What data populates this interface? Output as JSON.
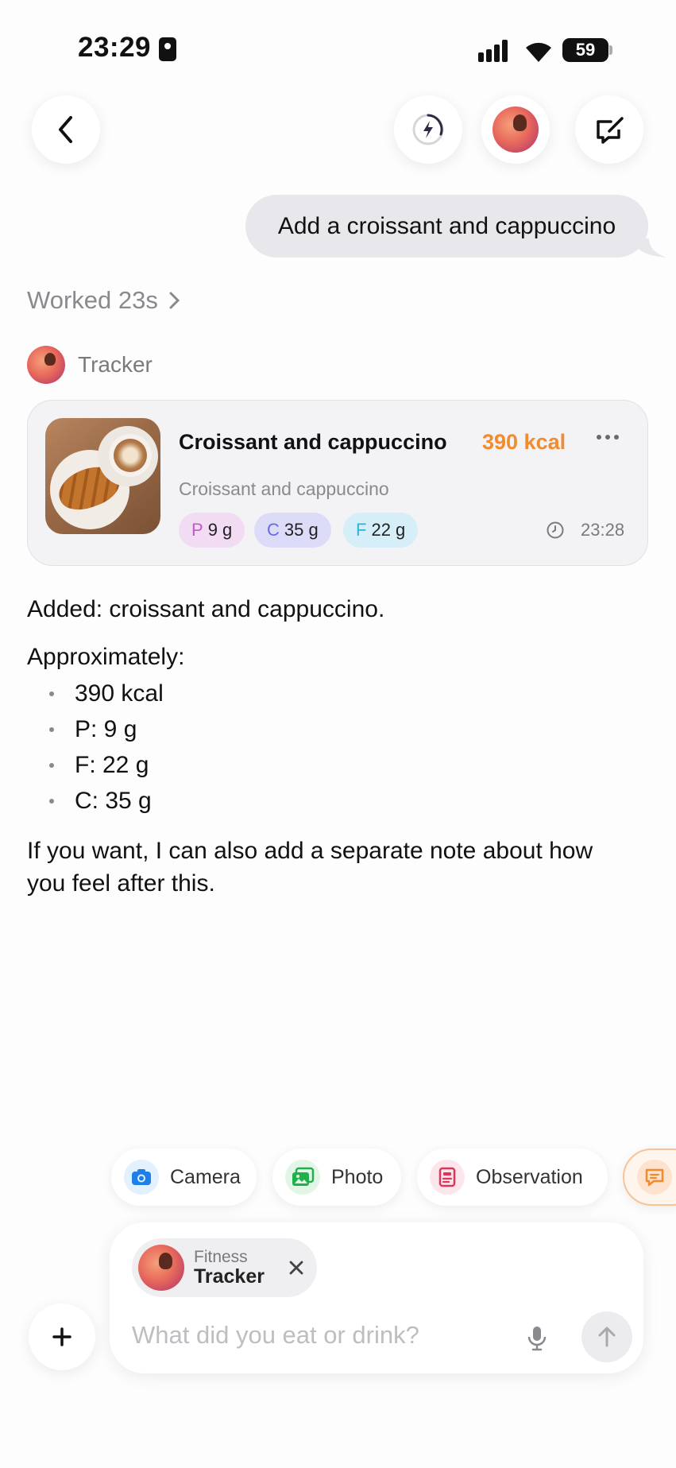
{
  "status_bar": {
    "time": "23:29",
    "battery": "59"
  },
  "conversation": {
    "user_message": "Add a croissant and cappuccino",
    "worked_label": "Worked 23s",
    "assistant_name": "Tracker"
  },
  "food_card": {
    "title": "Croissant and cappuccino",
    "kcal": "390 kcal",
    "subtitle": "Croissant and cappuccino",
    "macros": [
      {
        "letter": "P",
        "value": "9 g",
        "color": "#c457c9"
      },
      {
        "letter": "C",
        "value": "35 g",
        "color": "#6a6ae6"
      },
      {
        "letter": "F",
        "value": "22 g",
        "color": "#2ab6d8"
      }
    ],
    "time": "23:28"
  },
  "assistant_reply": {
    "line1": "Added: croissant and cappuccino.",
    "line2": "Approximately:",
    "items": [
      "390 kcal",
      "P: 9 g",
      "F: 22 g",
      "C: 35 g"
    ],
    "line3": "If you want, I can also add a separate note about how you feel after this."
  },
  "quick_actions": [
    {
      "label": "Camera",
      "icon": "camera-icon",
      "color": "#1f7fe8"
    },
    {
      "label": "Photo",
      "icon": "photo-icon",
      "color": "#22b04a"
    },
    {
      "label": "Observation",
      "icon": "note-icon",
      "color": "#e0355b"
    }
  ],
  "composer": {
    "tracker_small": "Fitness",
    "tracker_big": "Tracker",
    "placeholder": "What did you eat or drink?"
  },
  "colors": {
    "accent_kcal": "#f28a2e"
  }
}
